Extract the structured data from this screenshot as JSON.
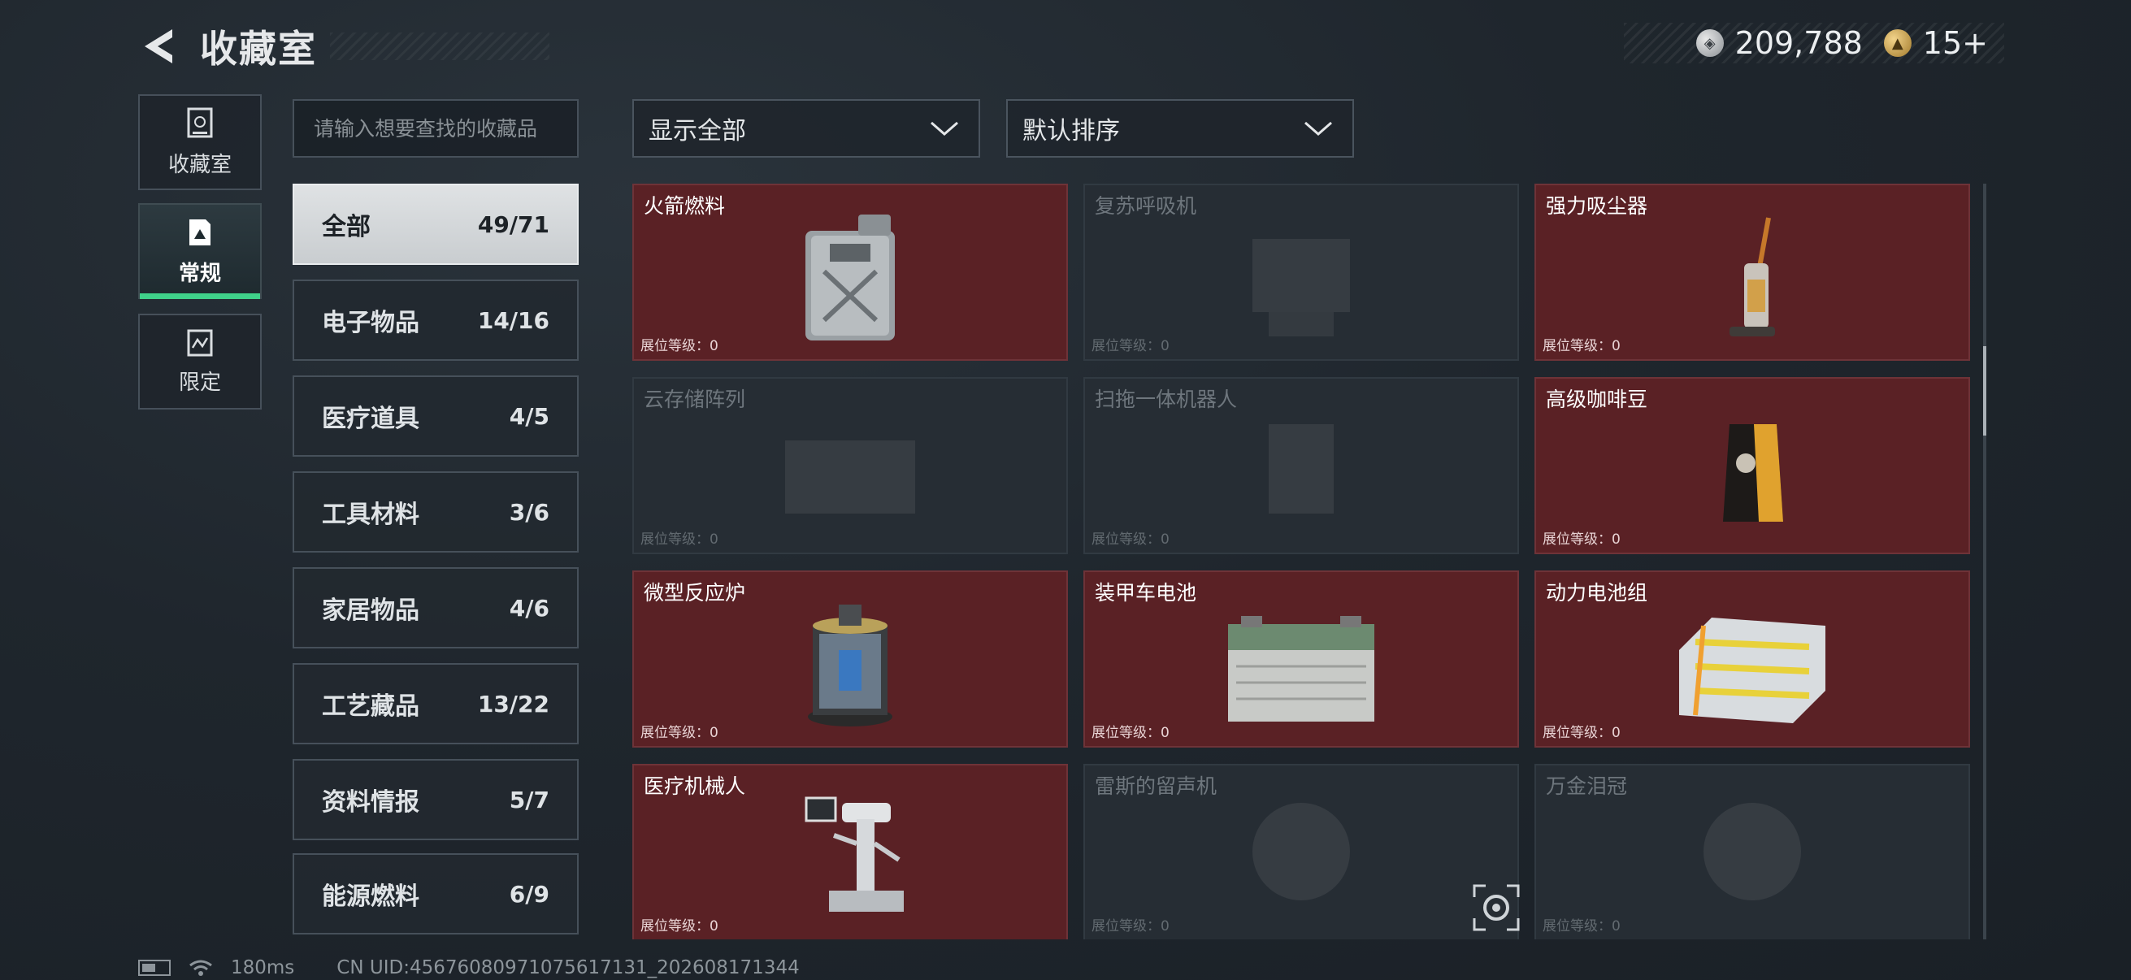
{
  "header": {
    "title": "收藏室"
  },
  "currency": {
    "silver_value": "209,788",
    "gold_value": "15+"
  },
  "nav": [
    {
      "id": "collection",
      "label": "收藏室",
      "active": false
    },
    {
      "id": "regular",
      "label": "常规",
      "active": true
    },
    {
      "id": "limited",
      "label": "限定",
      "active": false
    }
  ],
  "search": {
    "placeholder": "请输入想要查找的收藏品"
  },
  "filters": {
    "show": "显示全部",
    "sort": "默认排序"
  },
  "categories": [
    {
      "name": "全部",
      "count": "49/71",
      "active": true
    },
    {
      "name": "电子物品",
      "count": "14/16"
    },
    {
      "name": "医疗道具",
      "count": "4/5"
    },
    {
      "name": "工具材料",
      "count": "3/6"
    },
    {
      "name": "家居物品",
      "count": "4/6"
    },
    {
      "name": "工艺藏品",
      "count": "13/22"
    },
    {
      "name": "资料情报",
      "count": "5/7"
    },
    {
      "name": "能源燃料",
      "count": "6/9"
    }
  ],
  "items": [
    {
      "name": "火箭燃料",
      "level": "展位等级：0",
      "owned": true,
      "icon": "fuel-can-icon"
    },
    {
      "name": "复苏呼吸机",
      "level": "展位等级：0",
      "owned": false,
      "icon": "ventilator-icon"
    },
    {
      "name": "强力吸尘器",
      "level": "展位等级：0",
      "owned": true,
      "icon": "vacuum-icon"
    },
    {
      "name": "云存储阵列",
      "level": "展位等级：0",
      "owned": false,
      "icon": "storage-array-icon"
    },
    {
      "name": "扫拖一体机器人",
      "level": "展位等级：0",
      "owned": false,
      "icon": "robot-mop-icon"
    },
    {
      "name": "高级咖啡豆",
      "level": "展位等级：0",
      "owned": true,
      "icon": "coffee-bag-icon"
    },
    {
      "name": "微型反应炉",
      "level": "展位等级：0",
      "owned": true,
      "icon": "reactor-icon"
    },
    {
      "name": "装甲车电池",
      "level": "展位等级：0",
      "owned": true,
      "icon": "car-battery-icon"
    },
    {
      "name": "动力电池组",
      "level": "展位等级：0",
      "owned": true,
      "icon": "battery-pack-icon"
    },
    {
      "name": "医疗机械人",
      "level": "展位等级：0",
      "owned": true,
      "icon": "medical-robot-icon"
    },
    {
      "name": "雷斯的留声机",
      "level": "展位等级：0",
      "owned": false,
      "icon": "gramophone-icon"
    },
    {
      "name": "万金泪冠",
      "level": "展位等级：0",
      "owned": false,
      "icon": "crown-icon"
    }
  ],
  "footer": {
    "ping": "180ms",
    "uid": "CN UID:4567608097107561713​1_202608171344"
  },
  "colors": {
    "owned_card": "#5a2125",
    "locked_card": "#262d34",
    "active_accent": "#3fd18a"
  }
}
